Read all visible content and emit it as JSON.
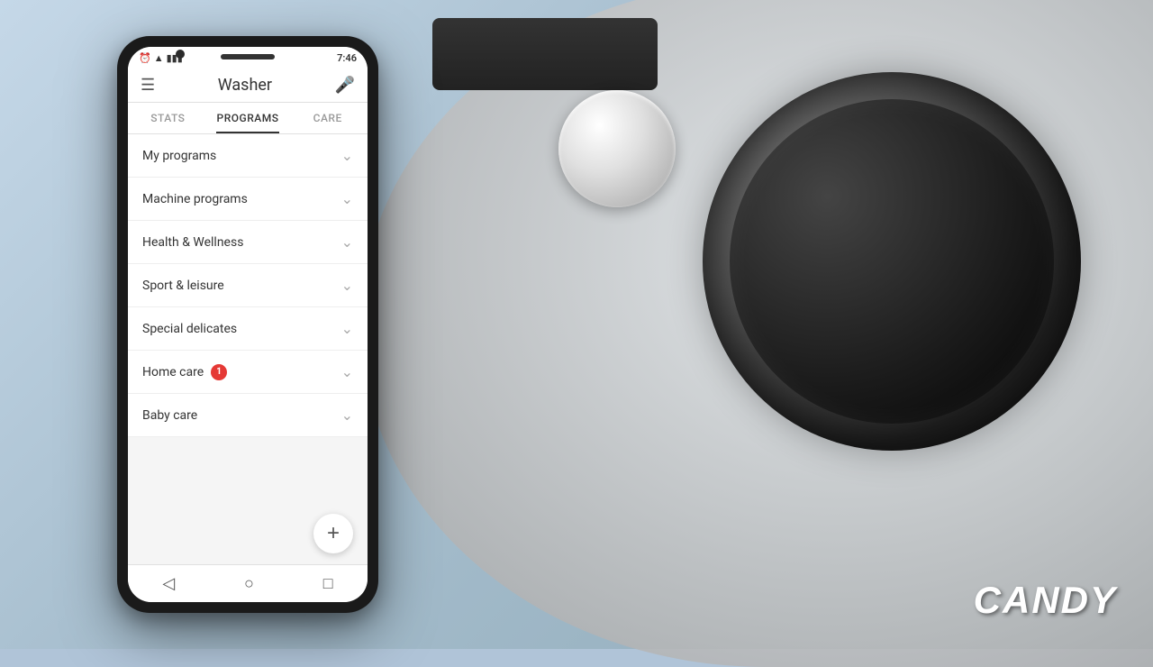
{
  "background": {
    "color": "#b0c4d8"
  },
  "candy_logo": {
    "text": "CANDY"
  },
  "phone": {
    "status_bar": {
      "time": "7:46",
      "icons": [
        "alarm",
        "wifi",
        "signal",
        "battery"
      ]
    },
    "top_bar": {
      "menu_icon": "☰",
      "title": "Washer",
      "mic_icon": "🎤"
    },
    "tabs": [
      {
        "label": "STATS",
        "active": false
      },
      {
        "label": "PROGRAMS",
        "active": true
      },
      {
        "label": "CARE",
        "active": false
      }
    ],
    "list_items": [
      {
        "label": "My programs",
        "badge": null
      },
      {
        "label": "Machine programs",
        "badge": null
      },
      {
        "label": "Health & Wellness",
        "badge": null
      },
      {
        "label": "Sport & leisure",
        "badge": null
      },
      {
        "label": "Special delicates",
        "badge": null
      },
      {
        "label": "Home care",
        "badge": "1"
      },
      {
        "label": "Baby care",
        "badge": null
      }
    ],
    "fab_label": "+",
    "nav": {
      "back": "◁",
      "home": "○",
      "recent": "□"
    }
  }
}
